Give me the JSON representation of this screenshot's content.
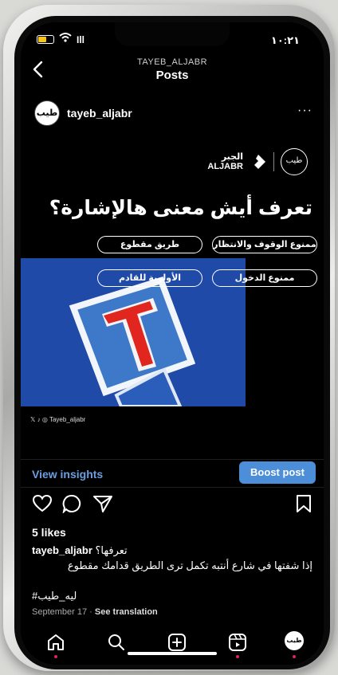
{
  "status": {
    "time": "١٠:٢١",
    "signal": "Ill"
  },
  "header": {
    "username": "TAYEB_ALJABR",
    "title": "Posts",
    "back_icon": "chevron-left-icon"
  },
  "post": {
    "avatar_text": "طيب",
    "username": "tayeb_aljabr",
    "more_icon": "more-horizontal-icon",
    "brand_mark": "طيب",
    "brand_name_ar": "الجبر",
    "brand_name_en": "ALJABR",
    "headline": "تعرف أيش معنى هالإشارة؟",
    "options": [
      "ممنوع الوقوف والانتظار",
      "طريق مقطوع",
      "ممنوع الدخول",
      "الأولوية للقادم"
    ],
    "social_handle": "Tayeb_aljabr",
    "sign_colors": {
      "blue": "#1f4aa8",
      "red": "#e0261f",
      "white": "#ffffff"
    }
  },
  "insights": {
    "view_insights": "View insights",
    "boost_post": "Boost post"
  },
  "likes": "5 likes",
  "caption": {
    "username": "tayeb_aljabr",
    "line1": "تعرفها؟",
    "line2": "إذا شفتها في شارع  أنتبه تكمل ترى الطريق قدامك مقطوع",
    "hashtag": "#ليه_طيب"
  },
  "meta": {
    "date": "September 17",
    "see_translation": "See translation"
  },
  "accent": "#4d8ed8"
}
